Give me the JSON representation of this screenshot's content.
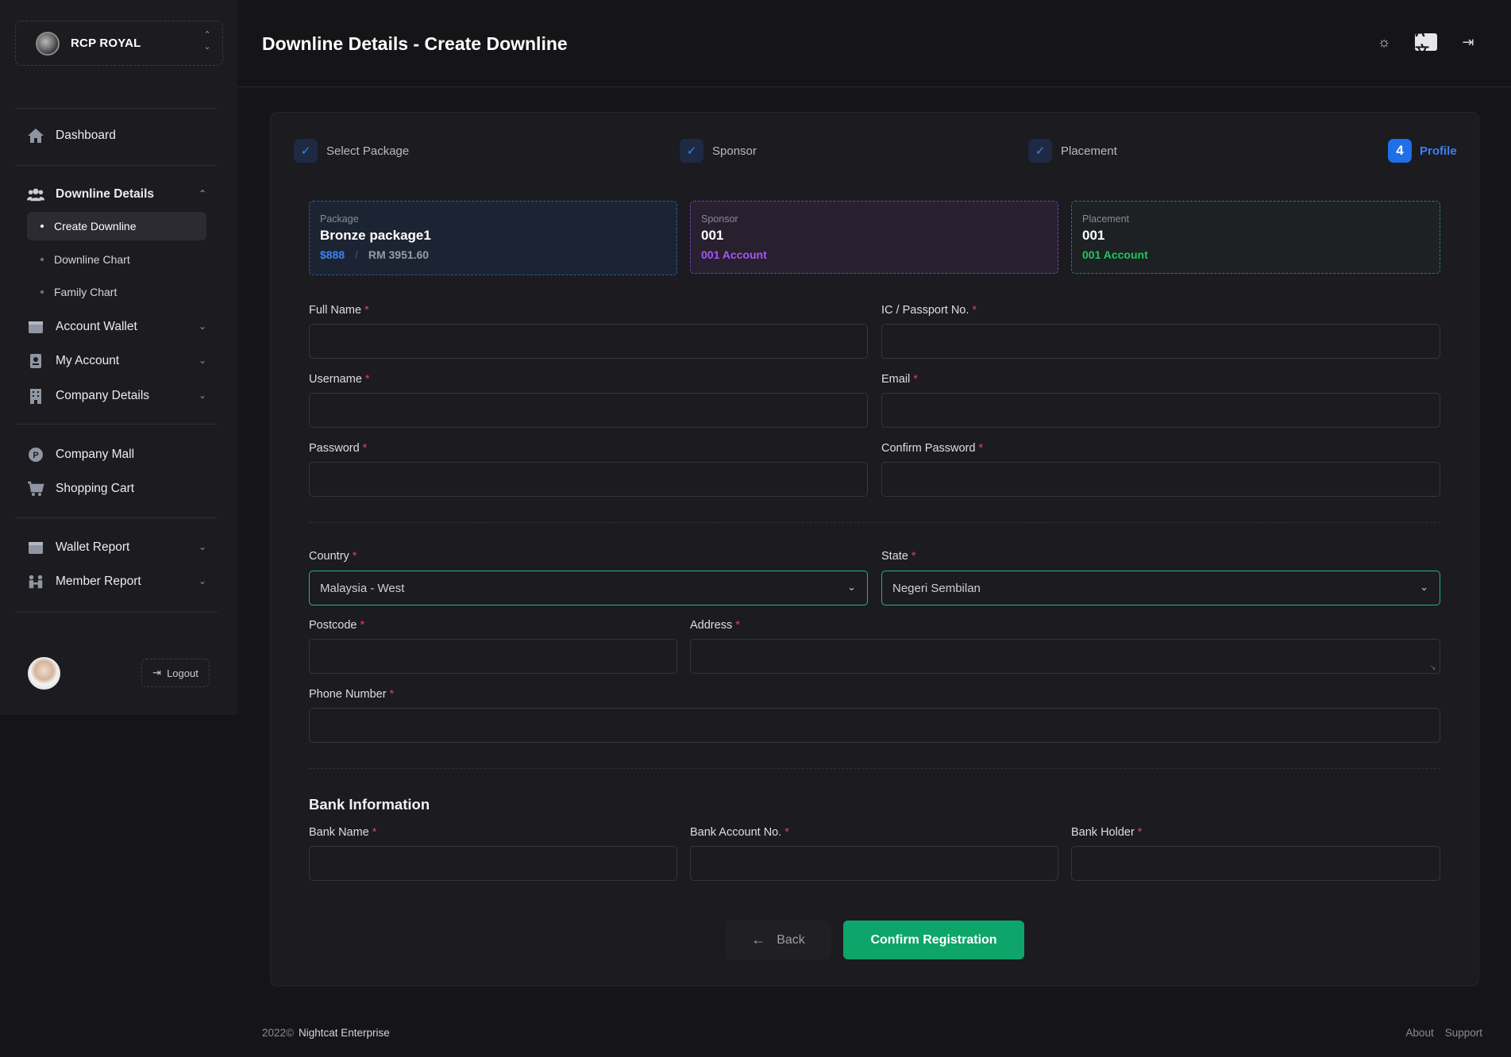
{
  "brand": {
    "name": "RCP ROYAL"
  },
  "nav": {
    "dashboard": "Dashboard",
    "downline_details": "Downline Details",
    "sub_items": [
      "Create Downline",
      "Downline Chart",
      "Family Chart"
    ],
    "account_wallet": "Account Wallet",
    "my_account": "My Account",
    "company_details": "Company Details",
    "company_mall": "Company Mall",
    "shopping_cart": "Shopping Cart",
    "wallet_report": "Wallet Report",
    "member_report": "Member Report",
    "logout": "Logout"
  },
  "header": {
    "title": "Downline Details - Create Downline"
  },
  "steps": [
    {
      "label": "Select Package",
      "state": "done"
    },
    {
      "label": "Sponsor",
      "state": "done"
    },
    {
      "label": "Placement",
      "state": "done"
    },
    {
      "label": "Profile",
      "number": "4",
      "state": "active"
    }
  ],
  "summary": {
    "package": {
      "label": "Package",
      "name": "Bronze package1",
      "usd": "$888",
      "sep": "/",
      "rm": "RM 3951.60"
    },
    "sponsor": {
      "label": "Sponsor",
      "id": "001",
      "account": "001 Account"
    },
    "placement": {
      "label": "Placement",
      "id": "001",
      "account": "001 Account"
    }
  },
  "form": {
    "full_name": {
      "label": "Full Name",
      "value": ""
    },
    "ic_passport": {
      "label": "IC / Passport No.",
      "value": ""
    },
    "username": {
      "label": "Username",
      "value": ""
    },
    "email": {
      "label": "Email",
      "value": ""
    },
    "password": {
      "label": "Password",
      "value": ""
    },
    "confirm_password": {
      "label": "Confirm Password",
      "value": ""
    },
    "country": {
      "label": "Country",
      "value": "Malaysia - West"
    },
    "state": {
      "label": "State",
      "value": "Negeri Sembilan"
    },
    "postcode": {
      "label": "Postcode",
      "value": ""
    },
    "address": {
      "label": "Address",
      "value": ""
    },
    "phone": {
      "label": "Phone Number",
      "value": ""
    },
    "required_mark": "*"
  },
  "bank": {
    "title": "Bank Information",
    "bank_name": {
      "label": "Bank Name",
      "value": ""
    },
    "account_no": {
      "label": "Bank Account No.",
      "value": ""
    },
    "holder": {
      "label": "Bank Holder",
      "value": ""
    }
  },
  "actions": {
    "back": "Back",
    "confirm": "Confirm Registration"
  },
  "footer": {
    "year": "2022©",
    "company": "Nightcat Enterprise",
    "links": [
      "About",
      "Support"
    ]
  },
  "colors": {
    "accent_blue": "#3b82f6",
    "accent_purple": "#a855f7",
    "accent_green": "#22c55e",
    "confirm_green": "#0ea56a",
    "required_red": "#e0405a"
  }
}
